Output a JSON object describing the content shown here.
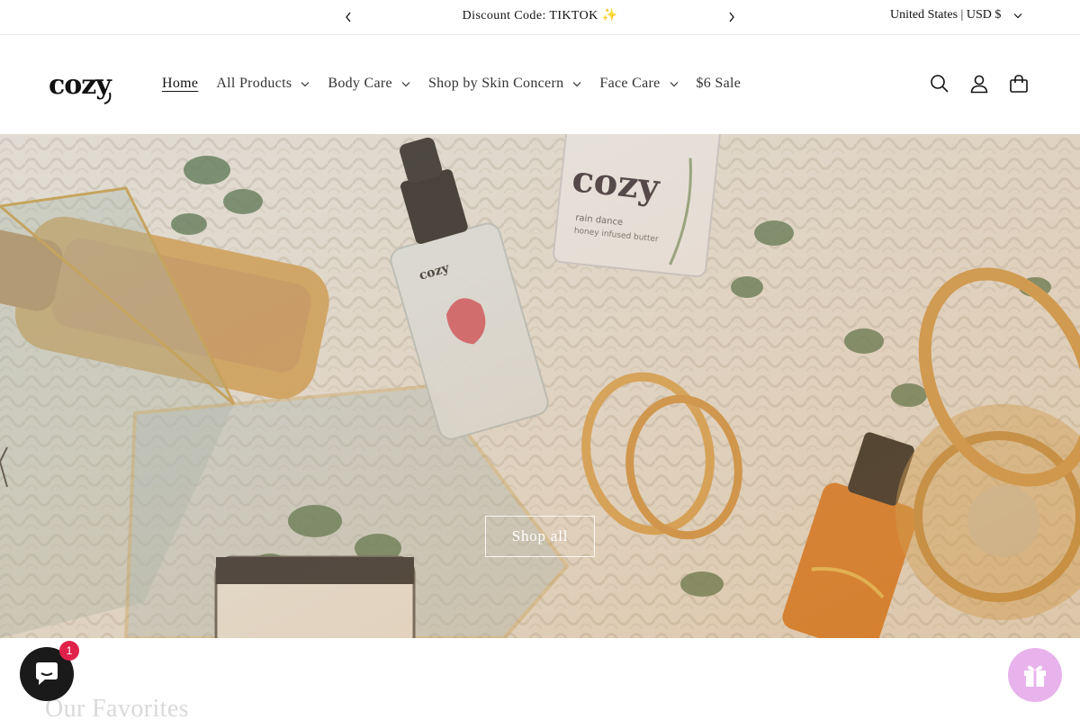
{
  "announcement": {
    "text": "Discount Code: TIKTOK ✨",
    "prev_icon": "chevron-left-icon",
    "next_icon": "chevron-right-icon"
  },
  "locale": {
    "label": "United States | USD $"
  },
  "header": {
    "logo_text": "cozy",
    "nav": [
      {
        "label": "Home",
        "active": true,
        "dropdown": false
      },
      {
        "label": "All Products",
        "dropdown": true
      },
      {
        "label": "Body Care",
        "dropdown": true
      },
      {
        "label": "Shop by Skin Concern",
        "dropdown": true
      },
      {
        "label": "Face Care",
        "dropdown": true
      },
      {
        "label": "$6 Sale",
        "dropdown": false
      }
    ],
    "icons": [
      "search-icon",
      "account-icon",
      "cart-icon"
    ]
  },
  "hero": {
    "button_label": "Shop all",
    "product_labels": [
      "cozy",
      "rain dance",
      "honey infused butter"
    ]
  },
  "section": {
    "title": "Our Favorites"
  },
  "widgets": {
    "chat_badge": "1",
    "chat_icon": "chat-icon",
    "gift_icon": "gift-icon"
  },
  "colors": {
    "accent_badge": "#e0224b",
    "gift_bg": "#e8b3ec"
  }
}
